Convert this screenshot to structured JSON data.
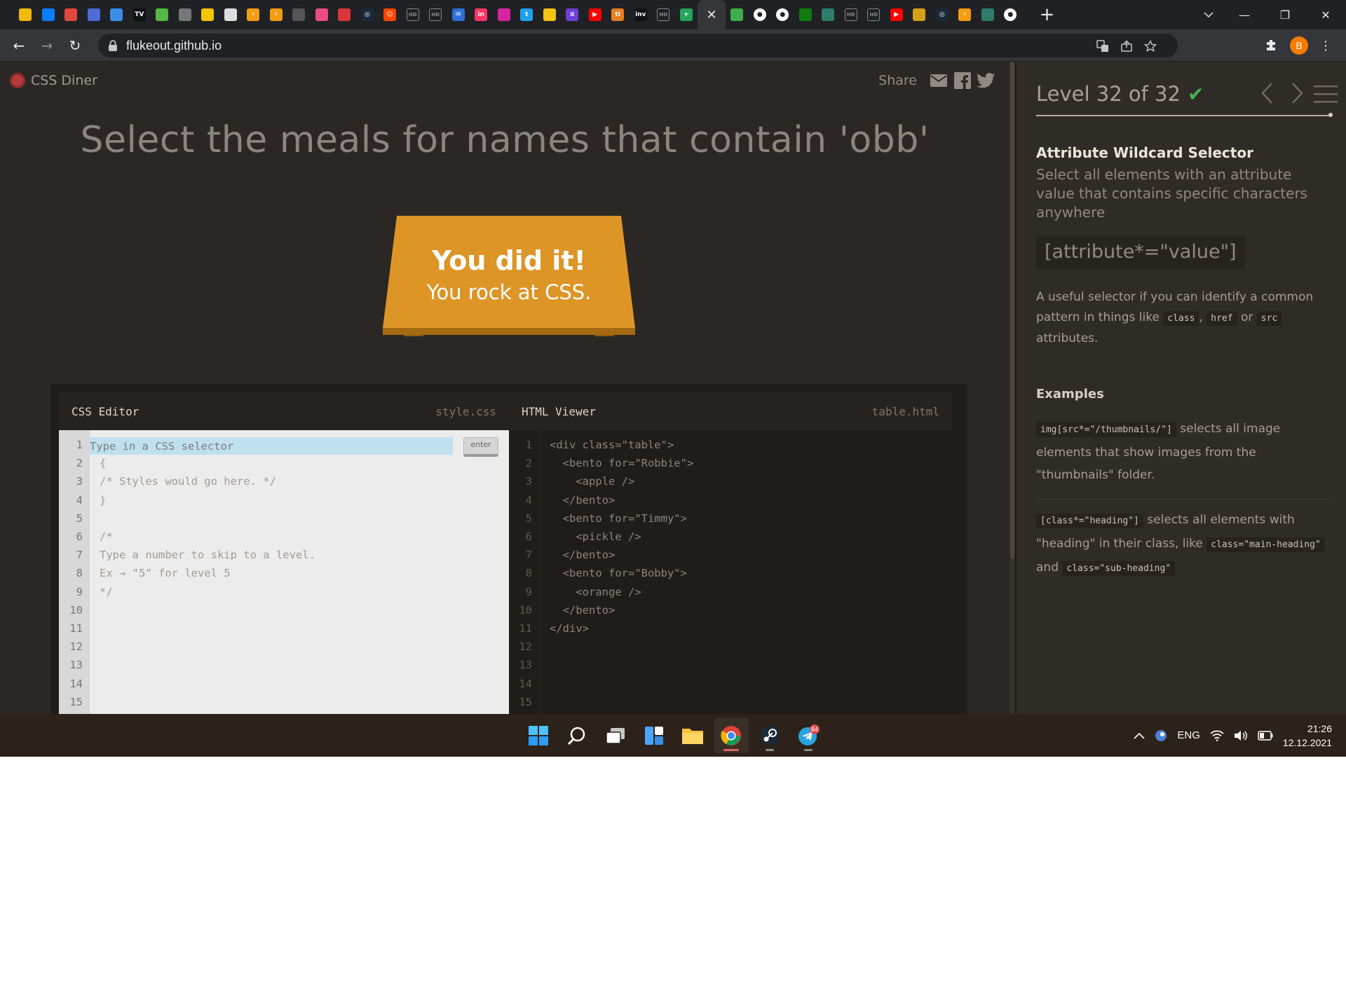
{
  "browser": {
    "url": "flukeout.github.io",
    "tabs": [
      {
        "icon": "binance-icon",
        "color": "#f0b90b"
      },
      {
        "icon": "messenger-icon",
        "color": "#0a7cff"
      },
      {
        "icon": "quora-like-icon",
        "color": "#e0483b"
      },
      {
        "icon": "moon-icon",
        "color": "#4c6bd6"
      },
      {
        "icon": "drop-icon",
        "color": "#3a8ee6"
      },
      {
        "icon": "tv-icon",
        "color": "#111111"
      },
      {
        "icon": "clover-icon",
        "color": "#56b947"
      },
      {
        "icon": "pen-icon",
        "color": "#777777"
      },
      {
        "icon": "color-bars-icon",
        "color": "#f5c400"
      },
      {
        "icon": "game-icon",
        "color": "#dddddd"
      },
      {
        "icon": "lightning-icon",
        "color": "#f39c12"
      },
      {
        "icon": "lightning-icon",
        "color": "#f39c12"
      },
      {
        "icon": "outline-circle-icon",
        "color": "#555555"
      },
      {
        "icon": "dribbble-icon",
        "color": "#ea4c89"
      },
      {
        "icon": "square-icon",
        "color": "#d9373b"
      },
      {
        "icon": "steam-icon",
        "color": "#1b2838"
      },
      {
        "icon": "reddit-icon",
        "color": "#ff4500"
      },
      {
        "icon": "hd-icon",
        "color": "#888888"
      },
      {
        "icon": "hd-icon",
        "color": "#888888"
      },
      {
        "icon": "mail-icon",
        "color": "#2f6fd6"
      },
      {
        "icon": "invision-icon",
        "color": "#ff3366"
      },
      {
        "icon": "instagram-icon",
        "color": "#d6249f"
      },
      {
        "icon": "twitter-icon",
        "color": "#1da1f2"
      },
      {
        "icon": "photo-icon",
        "color": "#f1c40f"
      },
      {
        "icon": "list-icon",
        "color": "#6c3fd6"
      },
      {
        "icon": "youtube-icon",
        "color": "#ff0000"
      },
      {
        "icon": "ti-icon",
        "color": "#e67e22"
      },
      {
        "icon": "inv-icon",
        "color": "#111111"
      },
      {
        "icon": "hd-icon",
        "color": "#888888"
      },
      {
        "icon": "plus-square-icon",
        "color": "#22a55b"
      },
      {
        "icon": "close-icon",
        "color": "#35363a",
        "active": true
      },
      {
        "icon": "frog-icon",
        "color": "#3fae4a"
      },
      {
        "icon": "github-icon",
        "color": "#ffffff"
      },
      {
        "icon": "github-icon",
        "color": "#ffffff"
      },
      {
        "icon": "xbox-icon",
        "color": "#107c10"
      },
      {
        "icon": "triangle-icon",
        "color": "#2e7d6b"
      },
      {
        "icon": "hd-icon",
        "color": "#888888"
      },
      {
        "icon": "hd-icon",
        "color": "#888888"
      },
      {
        "icon": "youtube-icon",
        "color": "#ff0000"
      },
      {
        "icon": "book-icon",
        "color": "#d4a017"
      },
      {
        "icon": "steam-icon",
        "color": "#1b2838"
      },
      {
        "icon": "lightning-icon",
        "color": "#f39c12"
      },
      {
        "icon": "triangle-icon",
        "color": "#2e7d6b"
      },
      {
        "icon": "github-icon",
        "color": "#ffffff"
      }
    ],
    "profile_initial": "B"
  },
  "game": {
    "logo_text": "CSS Diner",
    "share_label": "Share",
    "order_text": "Select the meals for names that contain 'obb'",
    "win_title": "You did it!",
    "win_subtitle": "You rock at CSS."
  },
  "css_editor": {
    "title": "CSS Editor",
    "file": "style.css",
    "placeholder": "Type in a CSS selector",
    "enter_label": "enter",
    "lines": [
      "{",
      "/* Styles would go here. */",
      "}",
      "",
      "/*",
      "Type a number to skip to a level.",
      "Ex → \"5\" for level 5",
      "*/",
      "",
      "",
      "",
      "",
      "",
      ""
    ],
    "line_numbers": [
      "1",
      "2",
      "3",
      "4",
      "5",
      "6",
      "7",
      "8",
      "9",
      "10",
      "11",
      "12",
      "13",
      "14",
      "15"
    ]
  },
  "html_viewer": {
    "title": "HTML Viewer",
    "file": "table.html",
    "lines": [
      "<div class=\"table\">",
      "  <bento for=\"Robbie\">",
      "    <apple />",
      "  </bento>",
      "  <bento for=\"Timmy\">",
      "    <pickle />",
      "  </bento>",
      "  <bento for=\"Bobby\">",
      "    <orange />",
      "  </bento>",
      "</div>",
      "",
      "",
      "",
      ""
    ],
    "line_numbers": [
      "1",
      "2",
      "3",
      "4",
      "5",
      "6",
      "7",
      "8",
      "9",
      "10",
      "11",
      "12",
      "13",
      "14",
      "15"
    ]
  },
  "sidebar": {
    "level_text": "Level 32 of 32",
    "progress": 1.0,
    "selector_name": "Attribute Wildcard Selector",
    "title": "Select all elements with an attribute value that contains specific characters anywhere",
    "syntax": "[attribute*=\"value\"]",
    "hint_before": "A useful selector if you can identify a common pattern in things like ",
    "hint_code1": "class",
    "hint_sep1": ", ",
    "hint_code2": "href",
    "hint_sep2": " or ",
    "hint_code3": "src",
    "hint_after": " attributes.",
    "examples_title": "Examples",
    "ex1_code": "img[src*=\"/thumbnails/\"]",
    "ex1_text": " selects all image elements that show images from the \"thumbnails\" folder.",
    "ex2_code": "[class*=\"heading\"]",
    "ex2_text": " selects all elements with \"heading\" in their class, like ",
    "ex2_code2": "class=\"main-heading\"",
    "ex2_and": " and ",
    "ex2_code3": "class=\"sub-heading\""
  },
  "taskbar": {
    "apps": [
      {
        "name": "windows-start-icon"
      },
      {
        "name": "search-icon"
      },
      {
        "name": "task-view-icon"
      },
      {
        "name": "widgets-icon"
      },
      {
        "name": "file-explorer-icon"
      },
      {
        "name": "chrome-icon",
        "running": true
      },
      {
        "name": "steam-icon"
      },
      {
        "name": "telegram-icon",
        "badge": "84"
      }
    ],
    "language": "ENG",
    "time": "21:26",
    "date": "12.12.2021"
  }
}
